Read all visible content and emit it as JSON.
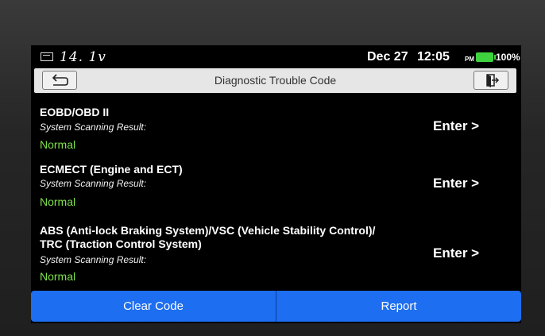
{
  "status_bar": {
    "voltage": "14. 1v",
    "date": "Dec 27",
    "time": "12:05",
    "ampm": "PM",
    "battery": "100%",
    "battery_level": 1.0,
    "battery_color": "#3fd23f"
  },
  "header": {
    "title": "Diagnostic Trouble Code",
    "back_icon": "back-arrow-icon",
    "exit_icon": "exit-door-icon"
  },
  "systems": [
    {
      "name": "EOBD/OBD II",
      "result_label": "System Scanning Result:",
      "result": "Normal",
      "action": "Enter >"
    },
    {
      "name": "ECMECT (Engine and ECT)",
      "result_label": "System Scanning Result:",
      "result": "Normal",
      "action": "Enter >"
    },
    {
      "name": "ABS (Anti-lock Braking System)/VSC (Vehicle Stability Control)/",
      "name_line2": "TRC (Traction Control System)",
      "result_label": "System Scanning Result:",
      "result": "Normal",
      "action": "Enter >"
    }
  ],
  "footer": {
    "clear_label": "Clear Code",
    "report_label": "Report"
  },
  "colors": {
    "accent": "#1d6ef0",
    "normal_status": "#7ee04a"
  }
}
